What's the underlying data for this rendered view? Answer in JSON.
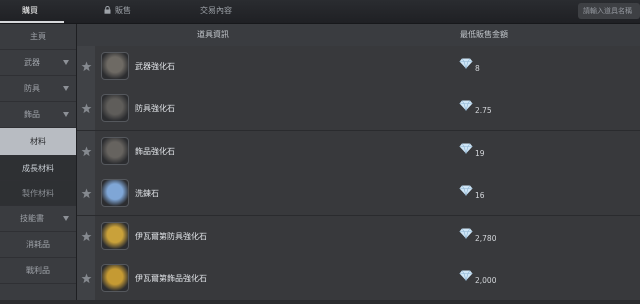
{
  "tabs": [
    {
      "label": "購買",
      "active": true
    },
    {
      "label": "販售",
      "icon": "lock-icon"
    },
    {
      "label": "交易內容"
    }
  ],
  "search": {
    "placeholder": "請輸入道具名稱"
  },
  "sidebar": {
    "items": [
      {
        "label": "主頁",
        "chevron": false
      },
      {
        "label": "武器",
        "chevron": true
      },
      {
        "label": "防具",
        "chevron": true
      },
      {
        "label": "飾品",
        "chevron": true
      },
      {
        "label": "材料",
        "chevron": false,
        "active": true
      },
      {
        "label": "成長材料",
        "chevron": false,
        "sub": true
      },
      {
        "label": "製作材料",
        "chevron": false,
        "sub": true
      },
      {
        "label": "技能書",
        "chevron": true
      },
      {
        "label": "消耗品",
        "chevron": false
      },
      {
        "label": "戰利品",
        "chevron": false
      }
    ]
  },
  "table": {
    "headers": {
      "item": "道具資訊",
      "price": "最低販售金額"
    },
    "rows": [
      {
        "name": "武器強化石",
        "price": "8",
        "icon": "weapon-enhance-stone-icon",
        "icon_color": "#6e6a64"
      },
      {
        "name": "防具強化石",
        "price": "2.75",
        "icon": "armor-enhance-stone-icon",
        "icon_color": "#5f5d5a"
      },
      {
        "name": "飾品強化石",
        "price": "19",
        "icon": "accessory-enhance-stone-icon",
        "icon_color": "#66635f"
      },
      {
        "name": "洗鍊石",
        "price": "16",
        "icon": "refining-stone-icon",
        "icon_color": "#7fa6d6"
      },
      {
        "name": "伊瓦爾第防具強化石",
        "price": "2,780",
        "icon": "ivaldi-armor-stone-icon",
        "icon_color": "#c9a13a"
      },
      {
        "name": "伊瓦爾第飾品強化石",
        "price": "2,000",
        "icon": "ivaldi-accessory-stone-icon",
        "icon_color": "#c59a33"
      }
    ]
  },
  "colors": {
    "accent": "#b8bcc2",
    "diamond": "#cfe6f7",
    "gold": "#c9a13a"
  }
}
